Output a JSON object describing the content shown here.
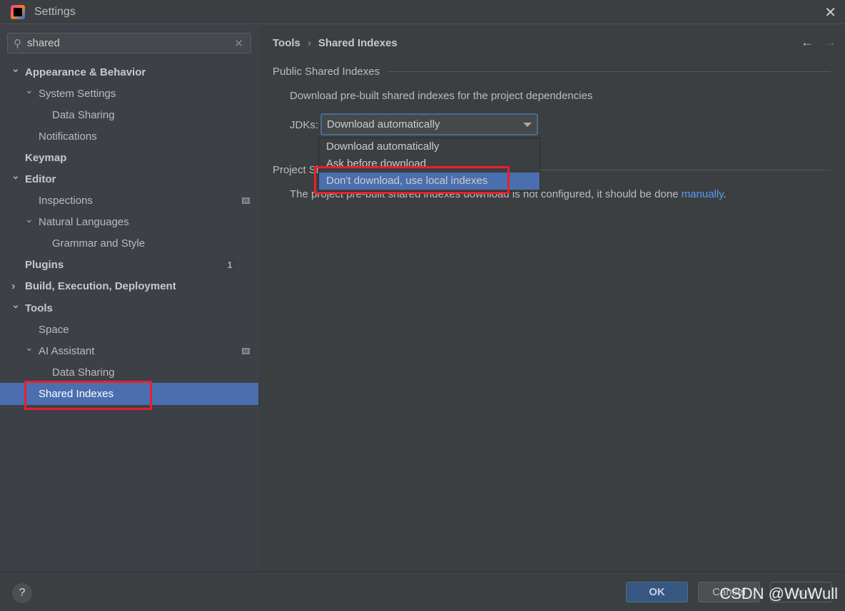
{
  "window": {
    "title": "Settings"
  },
  "search": {
    "value": "shared"
  },
  "tree": [
    {
      "label": "Appearance & Behavior",
      "level": 0,
      "arrow": "down",
      "bold": true
    },
    {
      "label": "System Settings",
      "level": 1,
      "arrow": "down"
    },
    {
      "label": "Data Sharing",
      "level": 2
    },
    {
      "label": "Notifications",
      "level": 1
    },
    {
      "label": "Keymap",
      "level": 0,
      "bold": true
    },
    {
      "label": "Editor",
      "level": 0,
      "arrow": "down",
      "bold": true
    },
    {
      "label": "Inspections",
      "level": 1,
      "project_icon": true
    },
    {
      "label": "Natural Languages",
      "level": 1,
      "arrow": "down"
    },
    {
      "label": "Grammar and Style",
      "level": 2
    },
    {
      "label": "Plugins",
      "level": 0,
      "bold": true,
      "badge": "1"
    },
    {
      "label": "Build, Execution, Deployment",
      "level": 0,
      "arrow": "right",
      "bold": true
    },
    {
      "label": "Tools",
      "level": 0,
      "arrow": "down",
      "bold": true
    },
    {
      "label": "Space",
      "level": 1
    },
    {
      "label": "AI Assistant",
      "level": 1,
      "arrow": "down",
      "project_icon": true
    },
    {
      "label": "Data Sharing",
      "level": 2
    },
    {
      "label": "Shared Indexes",
      "level": 1,
      "selected": true
    }
  ],
  "main": {
    "breadcrumb": [
      "Tools",
      "Shared Indexes"
    ],
    "section1": "Public Shared Indexes",
    "description": "Download pre-built shared indexes for the project dependencies",
    "jdks_label": "JDKs:",
    "jdks_value": "Download automatically",
    "options": [
      "Download automatically",
      "Ask before download",
      "Don't download, use local indexes"
    ],
    "selected_option": 2,
    "section2": "Project Shared Indexes",
    "project_text": "The project pre-built shared indexes download is not configured, it should be done ",
    "project_link": "manually",
    "project_end": "."
  },
  "footer": {
    "help": "?",
    "ok": "OK",
    "cancel": "Cancel",
    "apply": "Apply"
  },
  "watermark": "CSDN @WuWull",
  "colors": {
    "selection": "#4b6eaf",
    "highlight_box": "#e8202a",
    "link": "#589df6"
  }
}
